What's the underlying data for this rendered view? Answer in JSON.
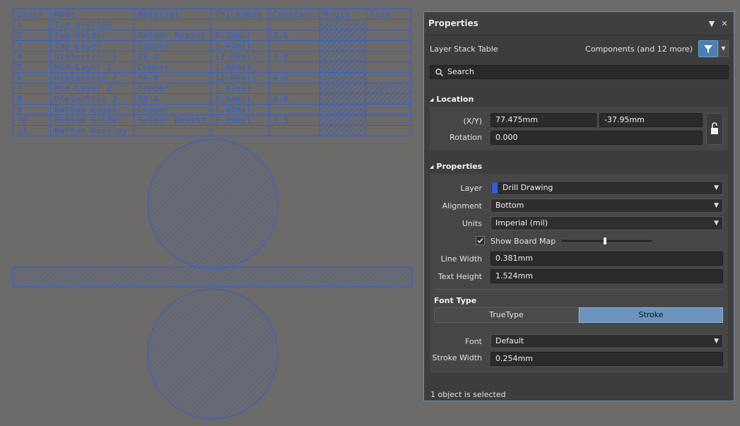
{
  "layer_stack": {
    "headers": [
      "Layer",
      "Name",
      "Material",
      "Thickness",
      "Constant",
      "Rigid",
      "Flex"
    ],
    "rows": [
      {
        "layer": "1",
        "name": "Top Overlay",
        "material": "",
        "thickness": "",
        "constant": "",
        "rigid": true,
        "flex": false
      },
      {
        "layer": "2",
        "name": "Top Solder",
        "material": "Solder Resist",
        "thickness": "0.39mil",
        "constant": "3.5",
        "rigid": true,
        "flex": false
      },
      {
        "layer": "3",
        "name": "Top Layer",
        "material": "Copper",
        "thickness": "1.42mil",
        "constant": "",
        "rigid": true,
        "flex": false
      },
      {
        "layer": "4",
        "name": "Dielectric 1",
        "material": "FR-4",
        "thickness": "12.60mil",
        "constant": "4.8",
        "rigid": true,
        "flex": false
      },
      {
        "layer": "5",
        "name": "Mid-Layer 1",
        "material": "Copper",
        "thickness": "1.42mil",
        "constant": "",
        "rigid": true,
        "flex": false
      },
      {
        "layer": "6",
        "name": "Dielectric 2",
        "material": "FR-4",
        "thickness": "12.60mil",
        "constant": "4.8",
        "rigid": true,
        "flex": false
      },
      {
        "layer": "7",
        "name": "Mid-Layer 2",
        "material": "Copper",
        "thickness": "1.42mil",
        "constant": "",
        "rigid": true,
        "flex": true
      },
      {
        "layer": "8",
        "name": "Dielectric 3",
        "material": "FR-4",
        "thickness": "3.94mil",
        "constant": "4.8",
        "rigid": true,
        "flex": true
      },
      {
        "layer": "9",
        "name": "Bottom Layer",
        "material": "Copper",
        "thickness": "1.42mil",
        "constant": "",
        "rigid": true,
        "flex": false
      },
      {
        "layer": "10",
        "name": "Bottom Solder",
        "material": "Solder Resist",
        "thickness": "0.39mil",
        "constant": "3.5",
        "rigid": true,
        "flex": false
      },
      {
        "layer": "11",
        "name": "Bottom Overlay",
        "material": "",
        "thickness": "",
        "constant": "",
        "rigid": true,
        "flex": false
      }
    ]
  },
  "panel": {
    "title": "Properties",
    "object_type": "Layer Stack Table",
    "filter_label": "Components (and 12 more)",
    "search_placeholder": "Search",
    "location": {
      "section_title": "Location",
      "xy_label": "(X/Y)",
      "x_value": "77.475mm",
      "y_value": "-37.95mm",
      "rotation_label": "Rotation",
      "rotation_value": "0.000"
    },
    "properties": {
      "section_title": "Properties",
      "layer_label": "Layer",
      "layer_value": "Drill Drawing",
      "layer_color": "#2f5fd8",
      "alignment_label": "Alignment",
      "alignment_value": "Bottom",
      "units_label": "Units",
      "units_value": "Imperial (mil)",
      "show_board_map_label": "Show Board Map",
      "show_board_map_checked": true,
      "board_map_slider": 0.5,
      "line_width_label": "Line Width",
      "line_width_value": "0.381mm",
      "text_height_label": "Text Height",
      "text_height_value": "1.524mm",
      "font_type_title": "Font Type",
      "font_type_options": [
        "TrueType",
        "Stroke"
      ],
      "font_type_selected": "Stroke",
      "font_label": "Font",
      "font_value": "Default",
      "stroke_width_label": "Stroke Width",
      "stroke_width_value": "0.254mm"
    },
    "status": "1 object is selected"
  },
  "colors": {
    "drawing_blue": "#2f5fd8",
    "accent": "#4a7fb5",
    "canvas_bg": "#6d6b69",
    "panel_bg": "#3d3d3d"
  }
}
